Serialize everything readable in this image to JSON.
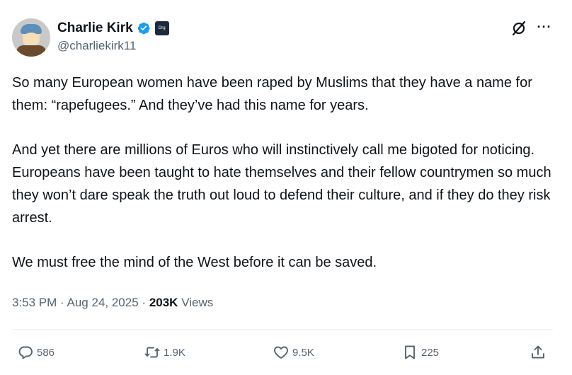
{
  "author": {
    "name": "Charlie Kirk",
    "handle": "@charliekirk11",
    "affiliation_badge": "Org"
  },
  "post": {
    "paragraphs": [
      "So many European women have been raped by Muslims that they have a name for them: “rapefugees.” And they’ve had this name for years.",
      "And yet there are millions of Euros who will instinctively call me bigoted for noticing. Europeans have been taught to hate themselves and their fellow countrymen so much they won’t dare speak the truth out loud to defend their culture, and if they do they risk arrest.",
      "We must free the mind of the West before it can be saved."
    ],
    "time": "3:53 PM",
    "date": "Aug 24, 2025",
    "separator": "·",
    "views_count": "203K",
    "views_label": "Views"
  },
  "actions": {
    "replies": "586",
    "reposts": "1.9K",
    "likes": "9.5K",
    "bookmarks": "225"
  },
  "icons": {
    "verified": "verified-badge-icon",
    "grok": "grok-icon",
    "more": "more-icon",
    "reply": "reply-icon",
    "repost": "repost-icon",
    "like": "heart-icon",
    "bookmark": "bookmark-icon",
    "share": "share-icon"
  },
  "colors": {
    "text": "#0f1419",
    "secondary": "#536471",
    "verified": "#1d9bf0",
    "divider": "#eff3f4"
  }
}
